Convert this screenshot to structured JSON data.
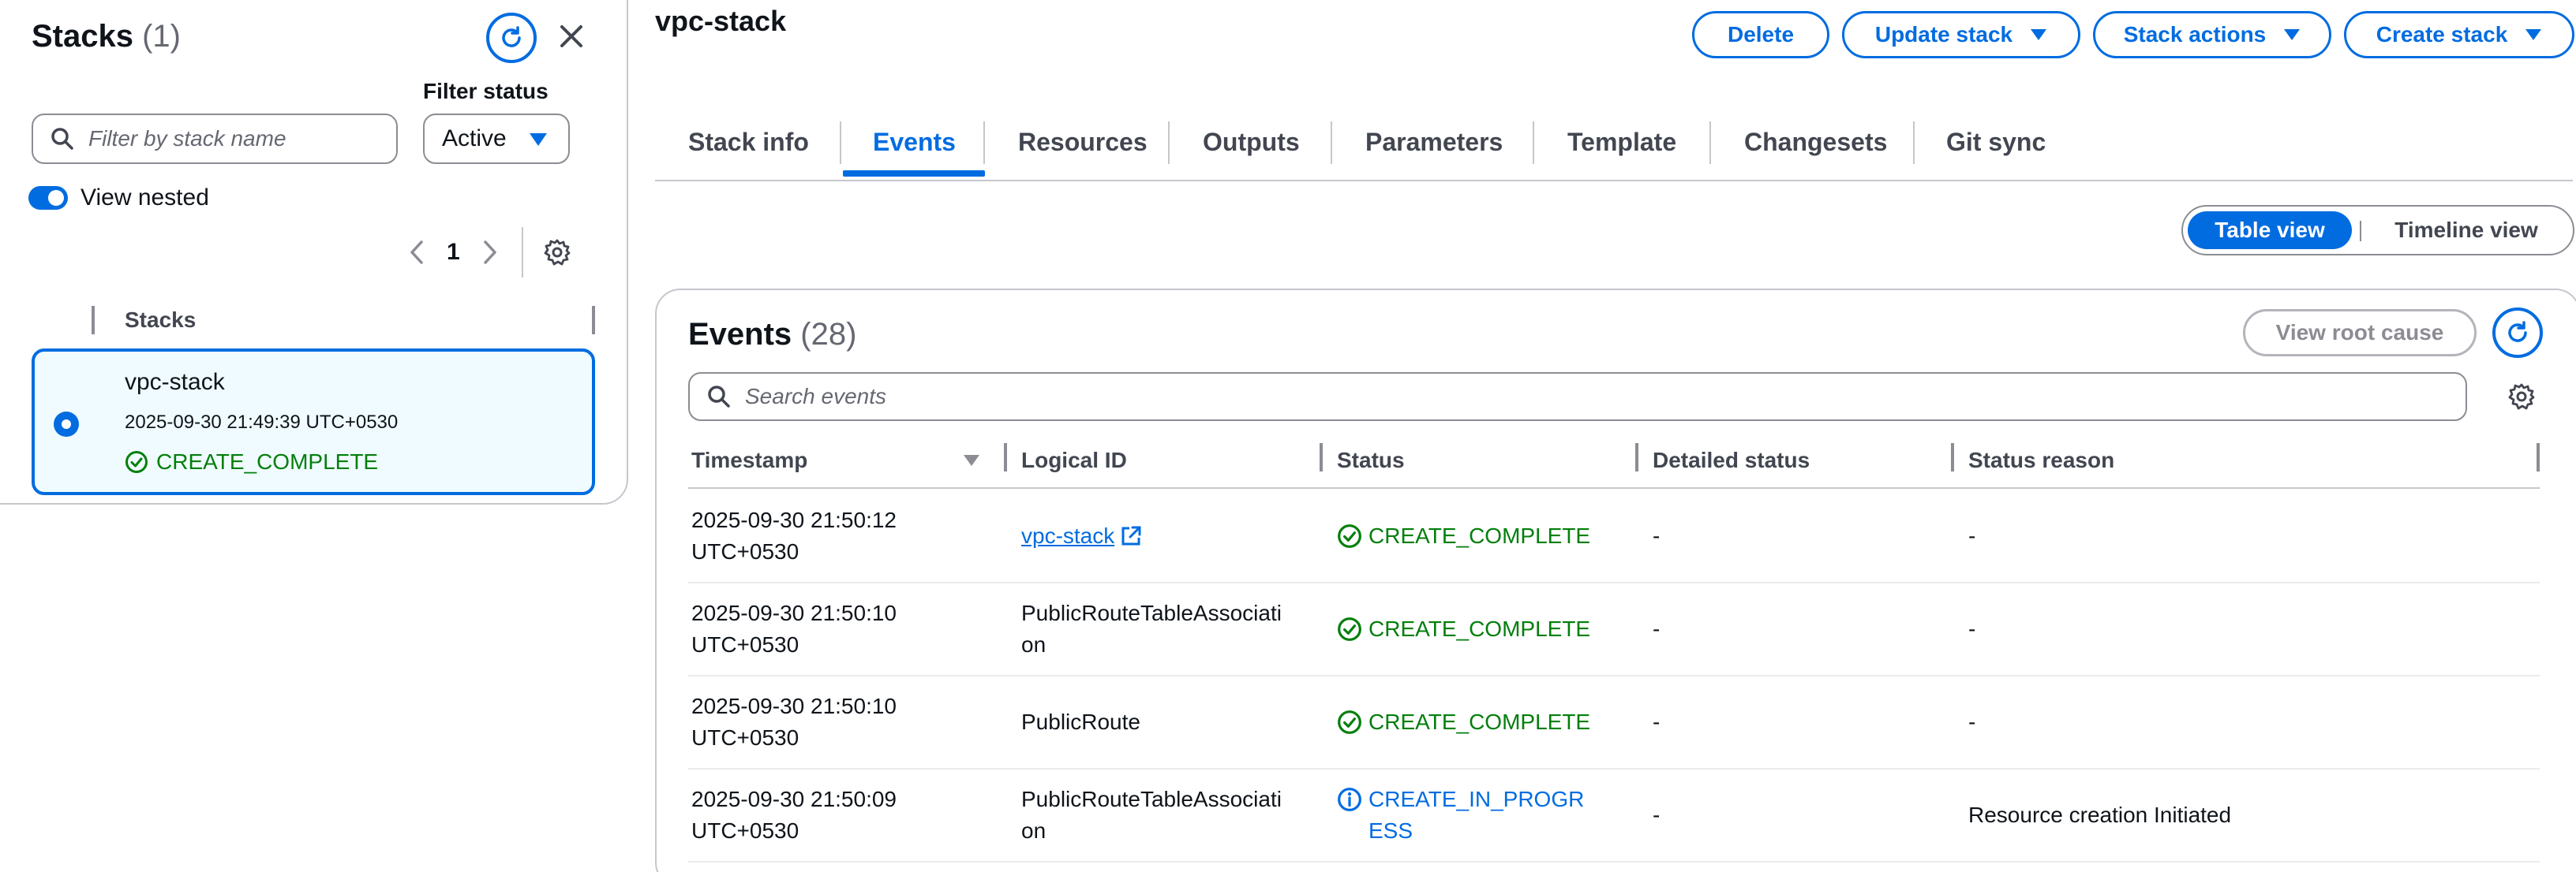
{
  "left_panel": {
    "title": "Stacks",
    "count": "(1)",
    "filter_status_label": "Filter status",
    "search_placeholder": "Filter by stack name",
    "filter_value": "Active",
    "view_nested_label": "View nested",
    "view_nested_enabled": true,
    "page_number": "1",
    "column_header": "Stacks",
    "selected_stack": {
      "name": "vpc-stack",
      "time": "2025-09-30 21:49:39 UTC+0530",
      "status": "CREATE_COMPLETE"
    }
  },
  "header": {
    "title": "vpc-stack",
    "buttons": {
      "delete": "Delete",
      "update": "Update stack",
      "actions": "Stack actions",
      "create": "Create stack"
    }
  },
  "tabs": [
    {
      "label": "Stack info"
    },
    {
      "label": "Events"
    },
    {
      "label": "Resources"
    },
    {
      "label": "Outputs"
    },
    {
      "label": "Parameters"
    },
    {
      "label": "Template"
    },
    {
      "label": "Changesets"
    },
    {
      "label": "Git sync"
    }
  ],
  "active_tab": "Events",
  "view_toggle": {
    "table": "Table view",
    "timeline": "Timeline view",
    "selected": "Table view"
  },
  "events": {
    "title": "Events",
    "count": "(28)",
    "root_cause_button": "View root cause",
    "search_placeholder": "Search events",
    "columns": [
      "Timestamp",
      "Logical ID",
      "Status",
      "Detailed status",
      "Status reason"
    ],
    "rows": [
      {
        "time1": "2025-09-30 21:50:12",
        "time2": "UTC+0530",
        "logical_id": "vpc-stack",
        "status": "CREATE_COMPLETE",
        "detailed": "-",
        "reason": "-"
      },
      {
        "time1": "2025-09-30 21:50:10",
        "time2": "UTC+0530",
        "logical_id": "PublicRouteTableAssociation",
        "status": "CREATE_COMPLETE",
        "detailed": "-",
        "reason": "-"
      },
      {
        "time1": "2025-09-30 21:50:10",
        "time2": "UTC+0530",
        "logical_id": "PublicRoute",
        "status": "CREATE_COMPLETE",
        "detailed": "-",
        "reason": "-"
      },
      {
        "time1": "2025-09-30 21:50:09",
        "time2": "UTC+0530",
        "logical_id": "PublicRouteTableAssociation",
        "status": "CREATE_IN_PROGRESS",
        "detailed": "-",
        "reason": "Resource creation Initiated"
      }
    ]
  },
  "colors": {
    "accent": "#006ce0",
    "success": "#037f0c",
    "border": "#c6c6cd",
    "text": "#0f141a"
  },
  "icons": [
    "refresh-icon",
    "close-icon",
    "search-icon",
    "caret-down-icon",
    "chevron-left-icon",
    "chevron-right-icon",
    "gear-icon",
    "success-icon",
    "info-icon",
    "external-link-icon",
    "sort-icon"
  ]
}
